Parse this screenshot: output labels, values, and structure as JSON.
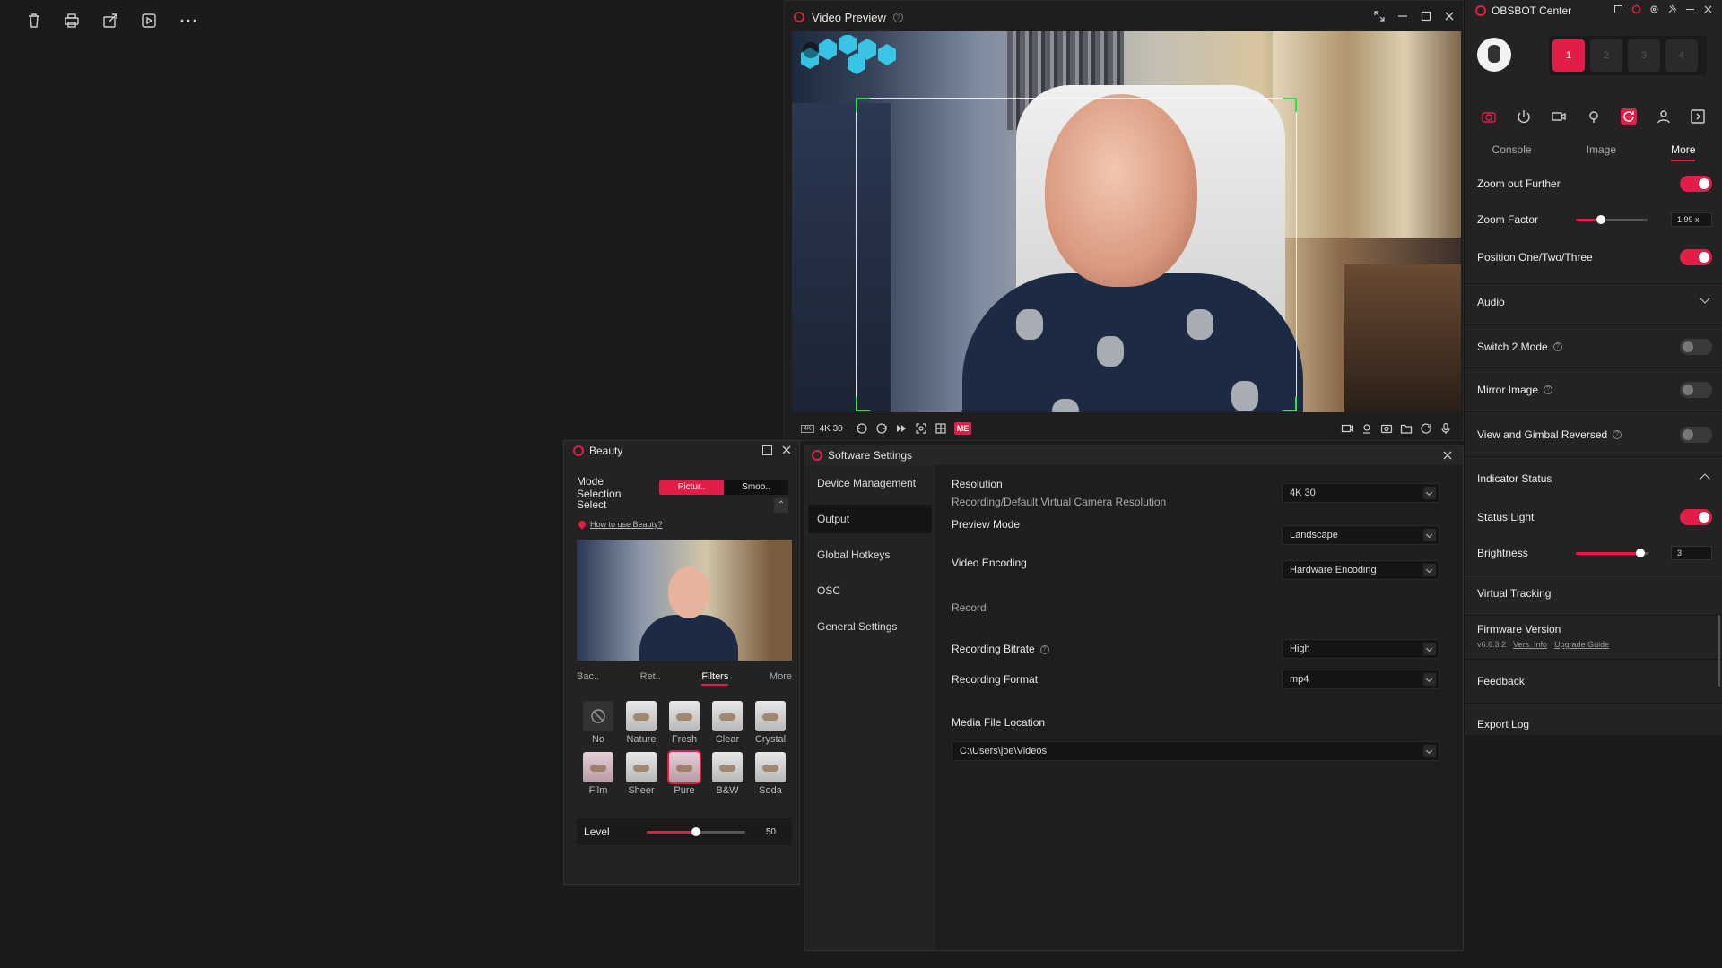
{
  "viewer_toolbar": {
    "icons": [
      "trash-icon",
      "print-icon",
      "share-icon",
      "slideshow-icon",
      "more-icon"
    ]
  },
  "video_preview": {
    "title": "Video Preview",
    "resolution": "4K 30",
    "resolution_badge": "4K",
    "me_badge": "ME"
  },
  "beauty": {
    "title": "Beauty",
    "mode_label": "Mode Selection",
    "mode_options": [
      "Pictur..",
      "Smoo.."
    ],
    "select_label": "Select",
    "howto_link": "How to use Beauty?",
    "tabs": [
      "Bac..",
      "Ret..",
      "Filters",
      "More"
    ],
    "active_tab": "Filters",
    "filters": [
      {
        "label": "No"
      },
      {
        "label": "Nature"
      },
      {
        "label": "Fresh"
      },
      {
        "label": "Clear"
      },
      {
        "label": "Crystal"
      },
      {
        "label": "Film"
      },
      {
        "label": "Sheer"
      },
      {
        "label": "Pure"
      },
      {
        "label": "B&W"
      },
      {
        "label": "Soda"
      }
    ],
    "selected_filter": "Pure",
    "level_label": "Level",
    "level_value": "50",
    "level_fraction": 0.5
  },
  "settings": {
    "title": "Software Settings",
    "nav": [
      "Device Management",
      "Output",
      "Global Hotkeys",
      "OSC",
      "General Settings"
    ],
    "active_nav": "Output",
    "resolution_label": "Resolution",
    "resolution_sub": "Recording/Default Virtual Camera Resolution",
    "resolution_value": "4K 30",
    "preview_mode_label": "Preview Mode",
    "preview_mode_value": "Landscape",
    "video_encoding_label": "Video Encoding",
    "video_encoding_value": "Hardware Encoding",
    "record_section": "Record",
    "bitrate_label": "Recording Bitrate",
    "bitrate_value": "High",
    "format_label": "Recording Format",
    "format_value": "mp4",
    "media_location_label": "Media File Location",
    "media_location_value": "C:\\Users\\joe\\Videos"
  },
  "obsbot": {
    "title": "OBSBOT Center",
    "device_slots": [
      "1",
      "2",
      "3",
      "4"
    ],
    "active_slot": "1",
    "tabs": [
      "Console",
      "Image",
      "More"
    ],
    "active_tab": "More",
    "zoom_out_further": "Zoom out Further",
    "zoom_factor": "Zoom Factor",
    "zoom_factor_value": "1.99 x",
    "zoom_factor_fraction": 0.35,
    "position_label": "Position One/Two/Three",
    "audio": "Audio",
    "switch2": "Switch 2 Mode",
    "mirror": "Mirror Image",
    "gimbal_reversed": "View and Gimbal Reversed",
    "indicator_status": "Indicator Status",
    "status_light": "Status Light",
    "brightness": "Brightness",
    "brightness_value": "3",
    "brightness_fraction": 0.9,
    "virtual_tracking": "Virtual Tracking",
    "firmware_label": "Firmware Version",
    "firmware_value": "v6.6.3.2",
    "vers_info": "Vers. Info",
    "upgrade_guide": "Upgrade Guide",
    "feedback": "Feedback",
    "export_log": "Export Log"
  },
  "colors": {
    "accent": "#e21d48",
    "tracking": "#2fe04a",
    "background": "#1b1b1b"
  }
}
